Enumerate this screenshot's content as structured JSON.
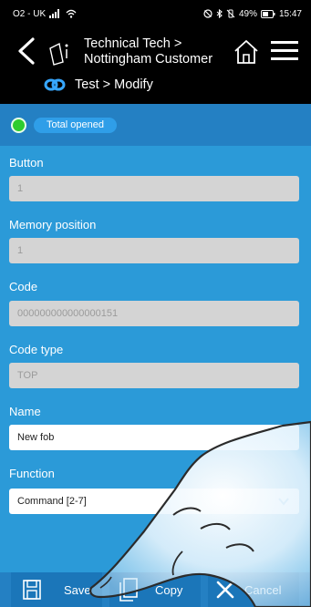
{
  "status_bar": {
    "carrier": "O2 - UK",
    "battery": "49%",
    "time": "15:47"
  },
  "header": {
    "breadcrumb_line1": "Technical Tech >",
    "breadcrumb_line2": "Nottingham Customer",
    "sub_breadcrumb": "Test > Modify"
  },
  "status": {
    "label": "Total opened",
    "color": "#2ecc2e"
  },
  "form": {
    "button": {
      "label": "Button",
      "value": "1"
    },
    "memory_position": {
      "label": "Memory position",
      "value": "1"
    },
    "code": {
      "label": "Code",
      "value": "000000000000000151"
    },
    "code_type": {
      "label": "Code type",
      "value": "TOP"
    },
    "name": {
      "label": "Name",
      "value": "New fob"
    },
    "function": {
      "label": "Function",
      "value": "Command [2-7]"
    }
  },
  "toolbar": {
    "save_label": "Save",
    "copy_label": "Copy",
    "cancel_label": "Cancel"
  },
  "icons": [
    "signal-icon",
    "wifi-icon",
    "back-icon",
    "document-icon",
    "home-icon",
    "menu-icon",
    "link-icon",
    "save-icon",
    "copy-icon",
    "cancel-icon"
  ]
}
